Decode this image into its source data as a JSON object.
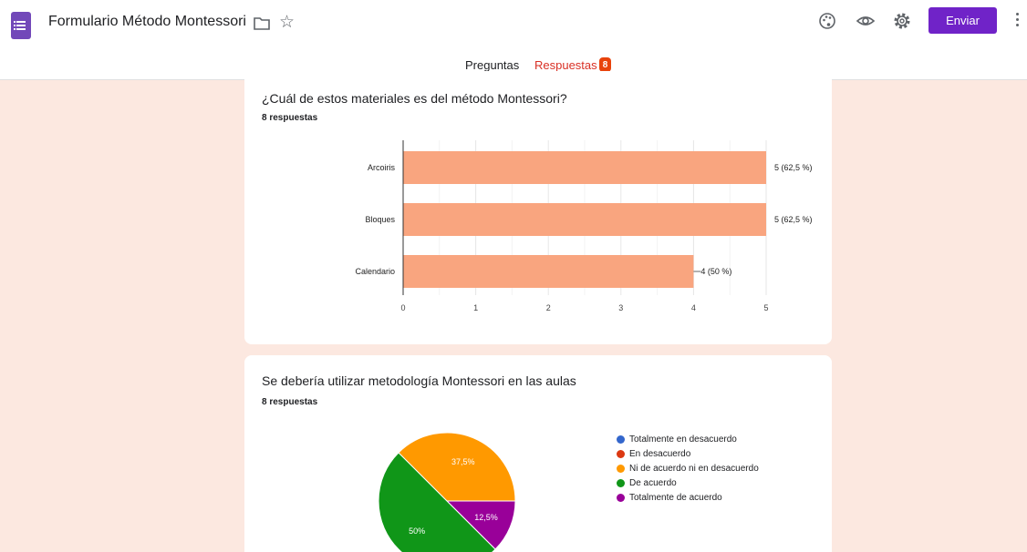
{
  "header": {
    "doc_title": "Formulario Método Montessori",
    "send_label": "Enviar",
    "icons": [
      "forms-app-icon",
      "folder-icon",
      "star-icon",
      "palette-icon",
      "eye-icon",
      "gear-icon",
      "more-vert-icon"
    ],
    "accent_color": "#7023c8"
  },
  "tabs": [
    {
      "label": "Preguntas",
      "active": false
    },
    {
      "label": "Respuestas",
      "active": true,
      "badge": "8"
    }
  ],
  "questions": [
    {
      "title": "¿Cuál de estos materiales es del método Montessori?",
      "count_label": "8 respuestas"
    },
    {
      "title": "Se debería utilizar metodología Montessori en las aulas",
      "count_label": "8 respuestas"
    }
  ],
  "chart_data": [
    {
      "type": "bar",
      "orientation": "horizontal",
      "categories": [
        "Arcoiris",
        "Bloques",
        "Calendario"
      ],
      "values": [
        5,
        5,
        4
      ],
      "data_labels": [
        "5 (62,5 %)",
        "5 (62,5 %)",
        "4 (50 %)"
      ],
      "xlim": [
        0,
        5
      ],
      "xticks": [
        "0",
        "1",
        "2",
        "3",
        "4",
        "5"
      ],
      "bar_color": "#f9a57f",
      "grid": true
    },
    {
      "type": "pie",
      "categories": [
        "Totalmente en desacuerdo",
        "En desacuerdo",
        "Ni de acuerdo ni en desacuerdo",
        "De acuerdo",
        "Totalmente de acuerdo"
      ],
      "values": [
        0,
        0,
        37.5,
        50,
        12.5
      ],
      "slice_labels": [
        "",
        "",
        "37,5%",
        "50%",
        "12,5%"
      ],
      "colors": [
        "#3366cc",
        "#dc3912",
        "#ff9900",
        "#109618",
        "#990099"
      ],
      "legend_position": "right"
    }
  ]
}
